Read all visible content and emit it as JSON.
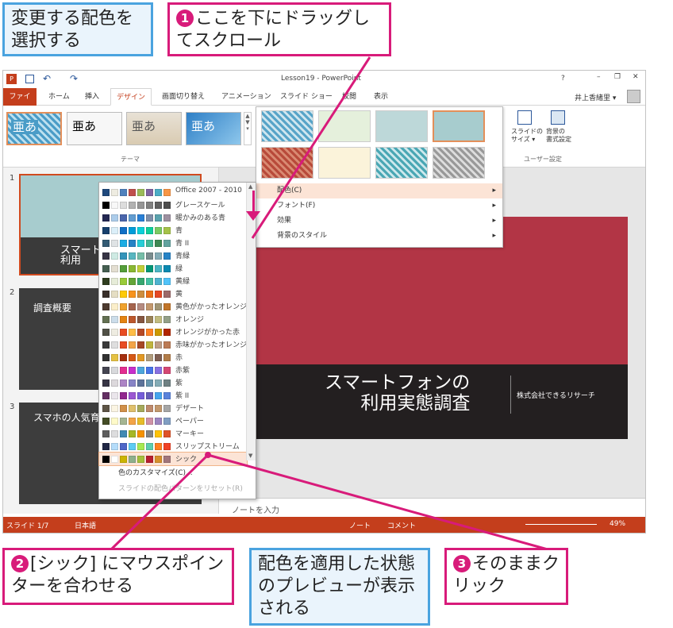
{
  "callouts": {
    "top_left": "変更する配色を選択する",
    "step1": "ここを下にドラッグしてスクロール",
    "step2": "[シック] にマウスポインターを合わせる",
    "preview": "配色を適用した状態のプレビューが表示される",
    "step3": "そのままクリック",
    "n1": "1",
    "n2": "2",
    "n3": "3"
  },
  "window": {
    "title": "Lesson19 - PowerPoint",
    "user": "井上香緒里 ▾",
    "help": "?"
  },
  "tabs": [
    "ファイル",
    "ホーム",
    "挿入",
    "デザイン",
    "画面切り替え",
    "アニメーション",
    "スライド ショー",
    "校閲",
    "表示"
  ],
  "ribbon": {
    "theme_label": "テーマ",
    "theme_text": "亜あ",
    "slide_size": "スライドの\nサイズ ▾",
    "bg_format": "背景の\n書式設定",
    "user_label": "ユーザー設定"
  },
  "variants_menu": {
    "items": [
      "配色(C)",
      "フォント(F)",
      "効果",
      "背景のスタイル"
    ]
  },
  "color_schemes": {
    "items": [
      {
        "name": "Office 2007 - 2010",
        "c": [
          "#1f497d",
          "#eeece1",
          "#4f81bd",
          "#c0504d",
          "#9bbb59",
          "#8064a2",
          "#4bacc6",
          "#f79646"
        ]
      },
      {
        "name": "グレースケール",
        "c": [
          "#000000",
          "#f8f8f8",
          "#dddddd",
          "#b2b2b2",
          "#969696",
          "#808080",
          "#5f5f5f",
          "#4d4d4d"
        ]
      },
      {
        "name": "暖かみのある青",
        "c": [
          "#242852",
          "#acccea",
          "#4a66ac",
          "#629dd1",
          "#297fd5",
          "#7f8fa9",
          "#5aa2ae",
          "#9d90a0"
        ]
      },
      {
        "name": "青",
        "c": [
          "#17406d",
          "#dbeff9",
          "#0f6fc6",
          "#009dd9",
          "#0bd0d9",
          "#10cf9b",
          "#7cca62",
          "#a5c249"
        ]
      },
      {
        "name": "青 II",
        "c": [
          "#335b74",
          "#dfe3e5",
          "#1cade4",
          "#2683c6",
          "#27ced7",
          "#42ba97",
          "#3e8853",
          "#62a39f"
        ]
      },
      {
        "name": "青緑",
        "c": [
          "#373545",
          "#ceeae3",
          "#3494ba",
          "#58b6c0",
          "#75bda7",
          "#7a8c8e",
          "#84acb6",
          "#2683c6"
        ]
      },
      {
        "name": "緑",
        "c": [
          "#455f51",
          "#e3ded1",
          "#549e39",
          "#8ab833",
          "#c0cf3a",
          "#029676",
          "#4ab5c4",
          "#0989b1"
        ]
      },
      {
        "name": "黄緑",
        "c": [
          "#2f3e1f",
          "#e6ecd8",
          "#99cb38",
          "#63a537",
          "#37a76f",
          "#44c1a3",
          "#4eb3cf",
          "#51c3f9"
        ]
      },
      {
        "name": "黄",
        "c": [
          "#39302a",
          "#e5dec3",
          "#ffca08",
          "#f8931d",
          "#ce8d3e",
          "#ec7016",
          "#e64823",
          "#9c6a6a"
        ]
      },
      {
        "name": "黄色がかったオレンジ",
        "c": [
          "#4e3b30",
          "#fbeec9",
          "#f0a22e",
          "#a5644e",
          "#b58b80",
          "#c3986d",
          "#a19574",
          "#c17529"
        ]
      },
      {
        "name": "オレンジ",
        "c": [
          "#637052",
          "#ccddea",
          "#e48312",
          "#bd582c",
          "#865640",
          "#9b8357",
          "#c2bc80",
          "#94a088"
        ]
      },
      {
        "name": "オレンジがかった赤",
        "c": [
          "#505046",
          "#eeece1",
          "#e84c22",
          "#ffbd47",
          "#b64926",
          "#ff8427",
          "#cc9900",
          "#b22600"
        ]
      },
      {
        "name": "赤味がかったオレンジ",
        "c": [
          "#3a3a3a",
          "#dedede",
          "#e84c22",
          "#f3a447",
          "#a64826",
          "#c0b43e",
          "#bf9e86",
          "#bc7b55"
        ]
      },
      {
        "name": "赤",
        "c": [
          "#323232",
          "#e5c243",
          "#a5300f",
          "#d55816",
          "#e19825",
          "#b19c7d",
          "#7f5f52",
          "#b27d49"
        ]
      },
      {
        "name": "赤紫",
        "c": [
          "#454551",
          "#d8d9dc",
          "#e32d91",
          "#c830cc",
          "#4ea6dc",
          "#4775e7",
          "#8971e1",
          "#d54773"
        ]
      },
      {
        "name": "紫",
        "c": [
          "#373545",
          "#dcd8dc",
          "#ad84c6",
          "#8784c7",
          "#5d739a",
          "#6997af",
          "#84acb6",
          "#6f8183"
        ]
      },
      {
        "name": "紫 II",
        "c": [
          "#632e62",
          "#eae5eb",
          "#92278f",
          "#9b57d3",
          "#755dd9",
          "#665eb8",
          "#45a5ed",
          "#5982db"
        ]
      },
      {
        "name": "デザート",
        "c": [
          "#5e5547",
          "#fbf5e3",
          "#d19049",
          "#e0c06c",
          "#a6a95b",
          "#bf8a6c",
          "#c3986d",
          "#a6a6a6"
        ]
      },
      {
        "name": "ペーパー",
        "c": [
          "#444d26",
          "#fefac9",
          "#a5b592",
          "#f3a447",
          "#e7bc29",
          "#d092a7",
          "#9c85c0",
          "#809ec2"
        ]
      },
      {
        "name": "マーキー",
        "c": [
          "#5e5e5e",
          "#ddddde",
          "#418ab3",
          "#a6b727",
          "#f69200",
          "#838383",
          "#fec306",
          "#df5327"
        ]
      },
      {
        "name": "スリップストリーム",
        "c": [
          "#212745",
          "#b4dcfa",
          "#4e67c8",
          "#5eccf3",
          "#a7ea52",
          "#5dceaf",
          "#ff8021",
          "#f14124"
        ]
      },
      {
        "name": "シック",
        "c": [
          "#000000",
          "#ffffff",
          "#ccb400",
          "#8fb08c",
          "#a6bf3b",
          "#b81e2f",
          "#d6902b",
          "#a1767c"
        ]
      }
    ],
    "customize": "色のカスタマイズ(C)...",
    "reset": "スライドの配色パターンをリセット(R)"
  },
  "slides": {
    "s1_title": "スマートフォンの\n利用実態調査",
    "s1_sub": "株式会社できるリサーチ",
    "s2_title": "調査概要",
    "s3_title": "スマホの人気育",
    "s1_short": "スマート\n利用",
    "nums": [
      "1",
      "2",
      "3"
    ]
  },
  "notes": "ノートを入力",
  "status": {
    "slide": "スライド 1/7",
    "lang": "日本語",
    "note": "ノート",
    "comment": "コメント",
    "zoom": "49%"
  }
}
